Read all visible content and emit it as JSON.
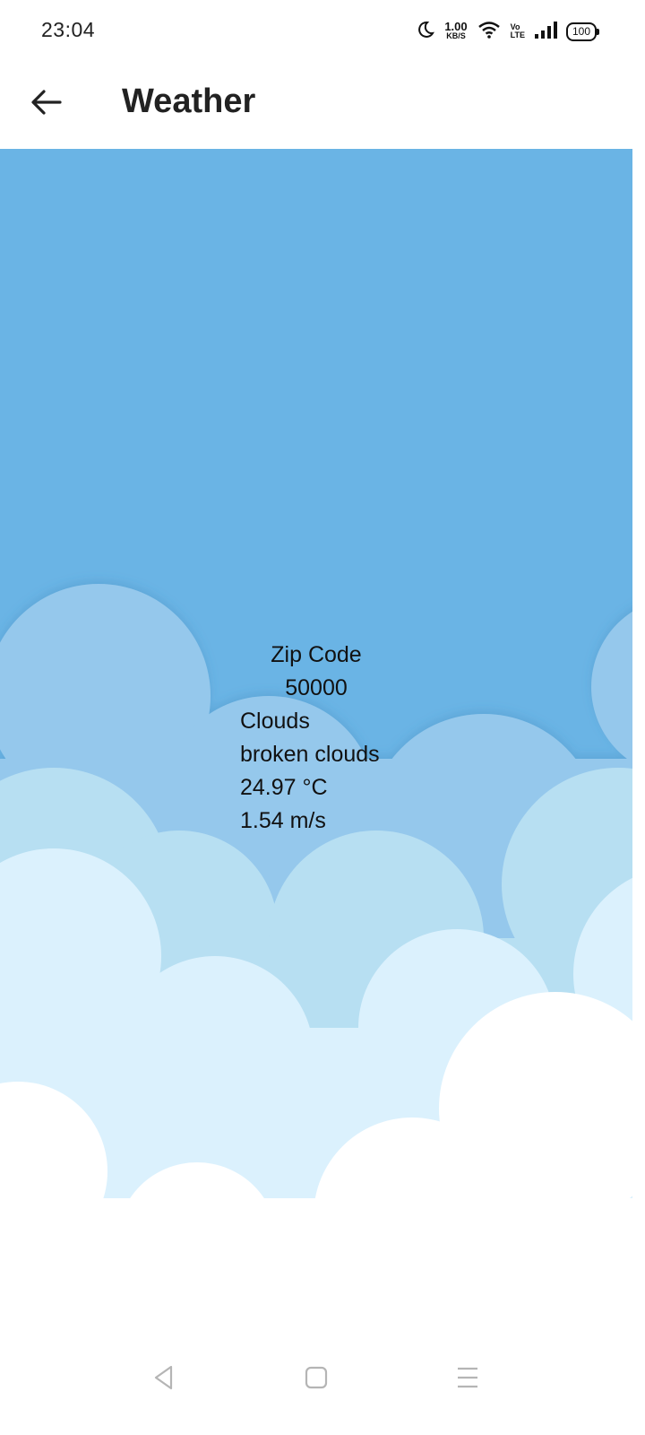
{
  "status_bar": {
    "time": "23:04",
    "net_speed_value": "1.00",
    "net_speed_unit": "KB/S",
    "volte_top": "Vo",
    "volte_bottom": "LTE",
    "battery": "100",
    "icons": [
      "moon-icon",
      "wifi-icon",
      "signal-icon",
      "battery-icon"
    ]
  },
  "app_bar": {
    "title": "Weather",
    "back_icon": "arrow-left-icon"
  },
  "weather": {
    "zip_label": "Zip Code",
    "zip_value": "50000",
    "condition": "Clouds",
    "description": "broken clouds",
    "temperature": "24.97 °C",
    "wind_speed": "1.54 m/s"
  },
  "colors": {
    "sky": "#6ab4e5",
    "cloud_layer_1": "#95c8ec",
    "cloud_layer_2": "#b7dff2",
    "cloud_layer_3": "#dbf1fd",
    "cloud_layer_4": "#ffffff"
  },
  "nav_bar": {
    "icons": [
      "back-triangle-icon",
      "home-square-icon",
      "menu-lines-icon"
    ]
  }
}
